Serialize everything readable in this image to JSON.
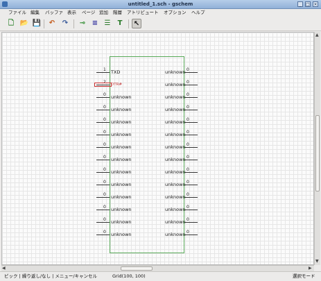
{
  "window": {
    "title": "untitled_1.sch - gschem",
    "minimize": "_",
    "maximize": "□",
    "close": "×"
  },
  "menu": [
    "ファイル",
    "編集",
    "バッファ",
    "表示",
    "ページ",
    "追加",
    "階層",
    "アトリビュート",
    "オプション",
    "ヘルプ"
  ],
  "toolbar": [
    {
      "name": "new-icon",
      "glyph": "🗋",
      "color": "#3a8a3a"
    },
    {
      "name": "open-icon",
      "glyph": "📂",
      "color": "#c89a2a"
    },
    {
      "name": "save-icon",
      "glyph": "💾",
      "color": "#3a5a8a"
    },
    {
      "name": "undo-icon",
      "glyph": "↶",
      "color": "#c45a1a"
    },
    {
      "name": "redo-icon",
      "glyph": "↷",
      "color": "#3a5a9a"
    },
    {
      "name": "add-component-icon",
      "glyph": "⊸",
      "color": "#2a8a2a"
    },
    {
      "name": "add-net-icon",
      "glyph": "≡",
      "color": "#2a2a9a"
    },
    {
      "name": "add-bus-icon",
      "glyph": "☰",
      "color": "#2a7a2a"
    },
    {
      "name": "add-text-icon",
      "glyph": "T",
      "color": "#2a7a2a"
    },
    {
      "name": "select-icon",
      "glyph": "↖",
      "color": "#111111"
    }
  ],
  "schematic": {
    "left_pins": [
      {
        "num": "1",
        "label": "TXD"
      },
      {
        "num": "2",
        "label": "DTR#",
        "selected": true
      },
      {
        "num": "0",
        "label": "unknown"
      },
      {
        "num": "0",
        "label": "unknown"
      },
      {
        "num": "0",
        "label": "unknown"
      },
      {
        "num": "0",
        "label": "unknown"
      },
      {
        "num": "0",
        "label": "unknown"
      },
      {
        "num": "0",
        "label": "unknown"
      },
      {
        "num": "0",
        "label": "unknown"
      },
      {
        "num": "0",
        "label": "unknown"
      },
      {
        "num": "0",
        "label": "unknown"
      },
      {
        "num": "0",
        "label": "unknown"
      },
      {
        "num": "0",
        "label": "unknown"
      },
      {
        "num": "0",
        "label": "unknown"
      }
    ],
    "right_pins": [
      {
        "num": "0",
        "label": "unknown"
      },
      {
        "num": "0",
        "label": "unknown"
      },
      {
        "num": "0",
        "label": "unknown"
      },
      {
        "num": "0",
        "label": "unknown"
      },
      {
        "num": "0",
        "label": "unknown"
      },
      {
        "num": "0",
        "label": "unknown"
      },
      {
        "num": "0",
        "label": "unknown"
      },
      {
        "num": "0",
        "label": "unknown"
      },
      {
        "num": "0",
        "label": "unknown"
      },
      {
        "num": "0",
        "label": "unknown"
      },
      {
        "num": "0",
        "label": "unknown"
      },
      {
        "num": "0",
        "label": "unknown"
      },
      {
        "num": "0",
        "label": "unknown"
      },
      {
        "num": "0",
        "label": "unknown"
      }
    ]
  },
  "status": {
    "left": "ピック | 繰り返し/なし | メニュー/キャンセル",
    "grid": "Grid(100, 100)",
    "mode": "選択モード"
  },
  "scroll": {
    "up": "▲",
    "down": "▼",
    "left": "◀",
    "right": "▶"
  }
}
